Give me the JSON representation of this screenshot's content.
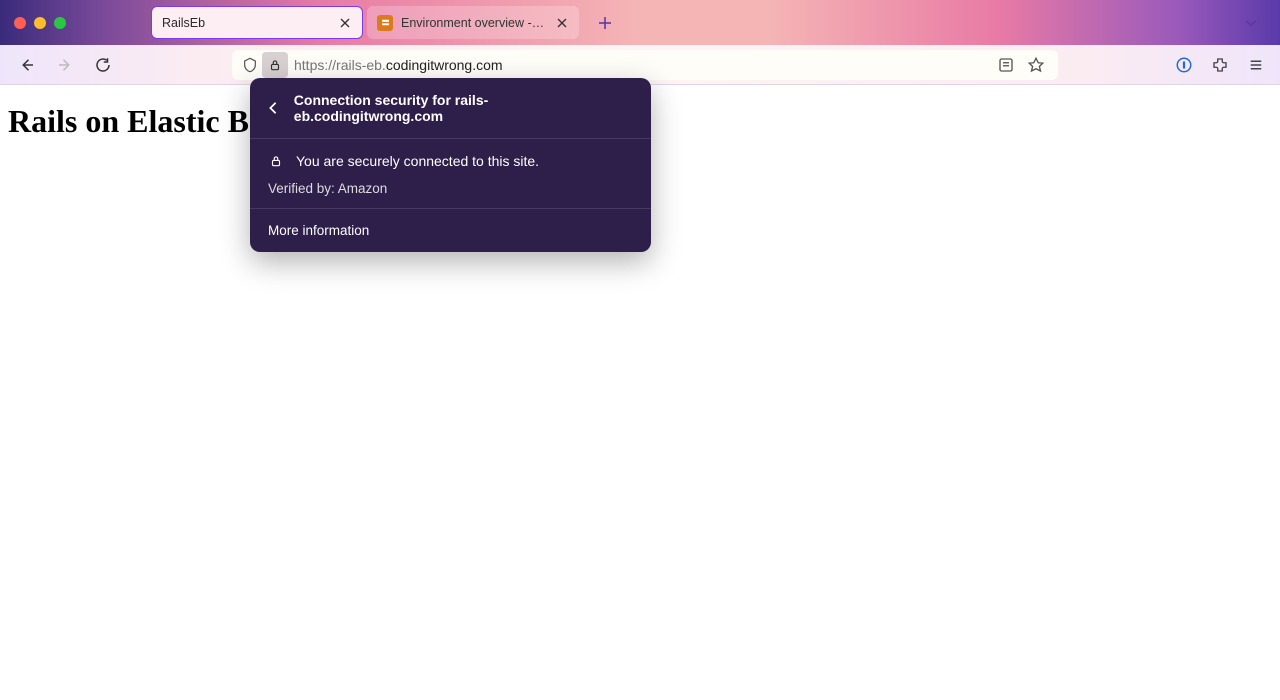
{
  "tabs": {
    "active": {
      "label": "RailsEb"
    },
    "inactive": {
      "label": "Environment overview - events"
    }
  },
  "url": {
    "scheme": "https://",
    "sub": "rails-eb.",
    "host": "codingitwrong.com"
  },
  "page": {
    "heading": "Rails on Elastic B"
  },
  "security_panel": {
    "title": "Connection security for rails-eb.codingitwrong.com",
    "secure_text": "You are securely connected to this site.",
    "verified_text": "Verified by: Amazon",
    "more_info": "More information"
  }
}
